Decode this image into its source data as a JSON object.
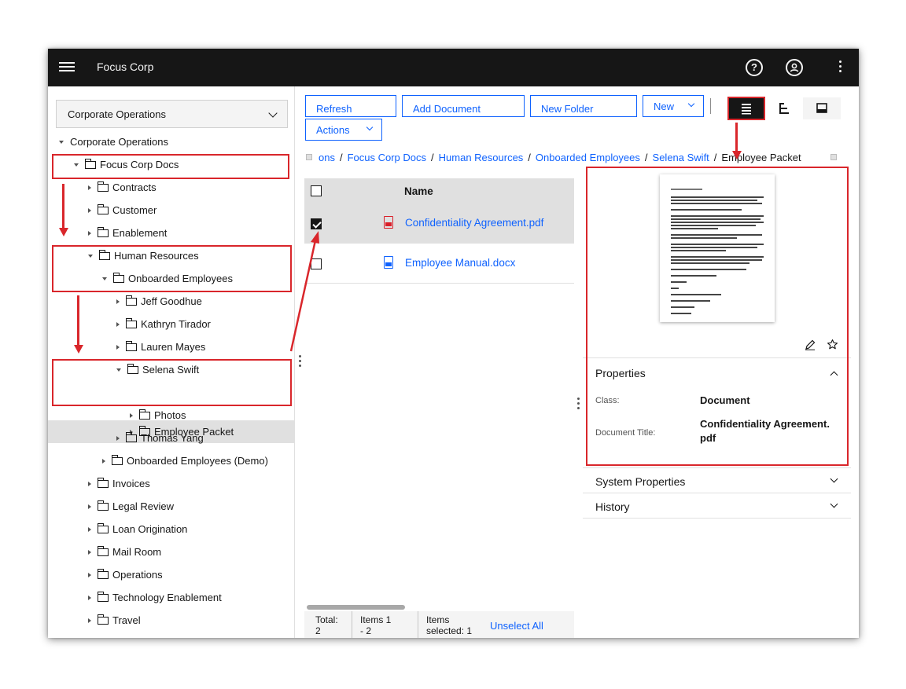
{
  "header": {
    "brand": "Focus Corp",
    "help_icon": "help-icon",
    "user_icon": "user-icon"
  },
  "left": {
    "repository_select": "Corporate Operations",
    "tree": [
      {
        "label": "Corporate Operations",
        "expanded": true,
        "level": 0
      },
      {
        "label": "Focus Corp Docs",
        "expanded": true,
        "level": 1
      },
      {
        "label": "Contracts",
        "level": 2
      },
      {
        "label": "Customer",
        "level": 2
      },
      {
        "label": "Enablement",
        "level": 2
      },
      {
        "label": "Human Resources",
        "expanded": true,
        "level": 2
      },
      {
        "label": "Onboarded Employees",
        "expanded": true,
        "level": 3
      },
      {
        "label": "Jeff Goodhue",
        "level": 4
      },
      {
        "label": "Kathryn Tirador",
        "level": 4
      },
      {
        "label": "Lauren Mayes",
        "level": 4
      },
      {
        "label": "Selena Swift",
        "expanded": true,
        "level": 4
      },
      {
        "label": "Employee Packet",
        "level": 5,
        "selected": true
      },
      {
        "label": "Photos",
        "level": 5
      },
      {
        "label": "Thomas Yang",
        "level": 4
      },
      {
        "label": "Onboarded Employees (Demo)",
        "level": 3
      },
      {
        "label": "Invoices",
        "level": 2
      },
      {
        "label": "Legal Review",
        "level": 2
      },
      {
        "label": "Loan Origination",
        "level": 2
      },
      {
        "label": "Mail Room",
        "level": 2
      },
      {
        "label": "Operations",
        "level": 2
      },
      {
        "label": "Technology Enablement",
        "level": 2
      },
      {
        "label": "Travel",
        "level": 2
      }
    ]
  },
  "toolbar": {
    "refresh": "Refresh",
    "add_document": "Add Document",
    "new_folder": "New Folder",
    "new": "New",
    "actions": "Actions"
  },
  "breadcrumb": {
    "items": [
      "ons",
      "Focus Corp Docs",
      "Human Resources",
      "Onboarded Employees",
      "Selena Swift"
    ],
    "current": "Employee Packet"
  },
  "table": {
    "name_header": "Name",
    "rows": [
      {
        "name": "Confidentiality Agreement.pdf",
        "checked": true,
        "type": "pdf-icon"
      },
      {
        "name": "Employee Manual.docx",
        "checked": false,
        "type": "docx-icon"
      }
    ]
  },
  "footer": {
    "total_label": "Total:",
    "total_value": "2",
    "items_label": "Items 1",
    "items_range": "- 2",
    "selected_label": "Items",
    "selected_value": "selected: 1",
    "unselect_all": "Unselect All"
  },
  "properties": {
    "title": "Properties",
    "class_label": "Class:",
    "class_value": "Document",
    "doc_title_label": "Document Title:",
    "doc_title_value_line1": "Confidentiality Agreement.",
    "doc_title_value_line2": "pdf",
    "system_properties": "System Properties",
    "history": "History"
  },
  "colors": {
    "accent": "#0f62fe",
    "header_bg": "#161616",
    "annotation_red": "#d9262b",
    "pdf_red": "#da1e28",
    "docx_blue": "#0f62fe"
  }
}
